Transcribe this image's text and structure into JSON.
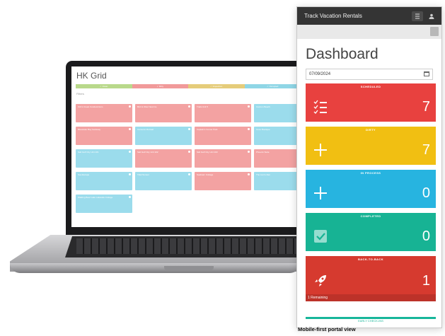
{
  "laptop": {
    "title": "HK Grid",
    "legend": [
      {
        "label": "✓ Clean",
        "color": "#b9d98b"
      },
      {
        "label": "✓ Dirty",
        "color": "#f19a9a"
      },
      {
        "label": "✓ Inspection",
        "color": "#e5cc7a"
      },
      {
        "label": "✓ Occupied",
        "color": "#8fd6e6"
      }
    ],
    "filters": "Filters",
    "cards": [
      {
        "label": "Kirk's Creek Condominium",
        "color": "#f3a2a2"
      },
      {
        "label": "Bird & Otter Nest Co.",
        "color": "#f3a2a2"
      },
      {
        "label": "Trails Unit 5",
        "color": "#f3a2a2"
      },
      {
        "label": "Cannon Beach",
        "color": "#9bdcec"
      },
      {
        "label": "Bluewater Bay Getaway",
        "color": "#f3a2a2"
      },
      {
        "label": "Cameron Retreat",
        "color": "#9bdcec"
      },
      {
        "label": "Captain's Corner Park",
        "color": "#f3a2a2"
      },
      {
        "label": "Cove Boutique",
        "color": "#9bdcec"
      },
      {
        "label": "Salt Gulf City Unit 101",
        "color": "#9bdcec"
      },
      {
        "label": "Salt Gulf City Unit 102",
        "color": "#f3a2a2"
      },
      {
        "label": "Salt Gulf City Unit 103",
        "color": "#f3a2a2"
      },
      {
        "label": "Phoenix Suite",
        "color": "#f3a2a2"
      },
      {
        "label": "Sea Escape",
        "color": "#9bdcec"
      },
      {
        "label": "Tidal Sunset",
        "color": "#9bdcec"
      },
      {
        "label": "Seafoam Cottage",
        "color": "#f3a2a2"
      },
      {
        "label": "The Lion's Den",
        "color": "#9bdcec"
      },
      {
        "label": "Walking Bear Lake Lakeside Cottage",
        "color": "#9bdcec"
      }
    ]
  },
  "phone": {
    "app_title": "Track Vacation Rentals",
    "menu_icon": "list-icon",
    "user_icon": "user-icon",
    "page_title": "Dashboard",
    "date_value": "07/09/2024",
    "cards": [
      {
        "name": "scheduled",
        "label": "SCHEDULED",
        "count": "7",
        "color": "#e8413f",
        "icon": "list-check-icon"
      },
      {
        "name": "dirty",
        "label": "DIRTY",
        "count": "7",
        "color": "#f1bf12",
        "icon": "plus-icon"
      },
      {
        "name": "in-process",
        "label": "IN PROCESS",
        "count": "0",
        "color": "#27b4e0",
        "icon": "plus-icon"
      },
      {
        "name": "completed",
        "label": "COMPLETED",
        "count": "0",
        "color": "#17b394",
        "icon": "checkbox-icon"
      },
      {
        "name": "back-to-back",
        "label": "BACK-TO-BACK",
        "count": "1",
        "color": "#d63a2f",
        "icon": "rocket-icon",
        "footer": "1 Remaining"
      }
    ],
    "partial_card_label": "EARLY CHECK-INS"
  },
  "caption": "Mobile-first portal view"
}
